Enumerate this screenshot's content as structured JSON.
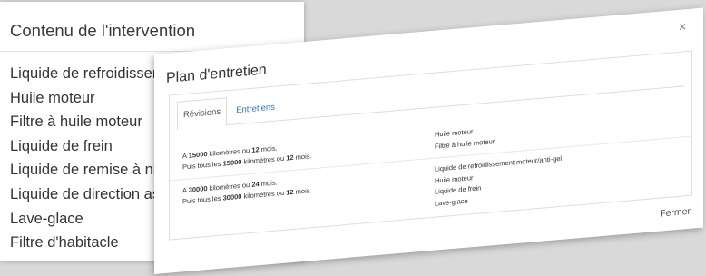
{
  "intervention": {
    "title": "Contenu de l'intervention",
    "items": [
      "Liquide de refroidissem",
      "Huile moteur",
      "Filtre à huile moteur",
      "Liquide de frein",
      "Liquide de remise à nive",
      "Liquide de direction assi",
      "Lave-glace",
      "Filtre d'habitacle"
    ]
  },
  "modal": {
    "title": "Plan d'entretien",
    "close_icon": "×",
    "tabs": [
      {
        "label": "Révisions",
        "active": true
      },
      {
        "label": "Entretiens",
        "active": false
      }
    ],
    "rows": [
      {
        "interval": [
          [
            "A ",
            "15000",
            " kilomètres ou ",
            "12",
            " mois."
          ],
          [
            "Puis tous les ",
            "15000",
            " kilomètres ou ",
            "12",
            " mois."
          ]
        ],
        "operations": [
          "Huile moteur",
          "Filtre à huile moteur"
        ]
      },
      {
        "interval": [
          [
            "A ",
            "30000",
            " kilomètres ou ",
            "24",
            " mois."
          ],
          [
            "Puis tous les ",
            "30000",
            " kilomètres ou ",
            "12",
            " mois."
          ]
        ],
        "operations": [
          "Liquide de refroidissement moteur/anti-gel",
          "Huile moteur",
          "Liquide de frein",
          "Lave-glace"
        ]
      }
    ],
    "close_button": "Fermer"
  },
  "colors": {
    "link": "#2f76c0",
    "stage_background": "#d9d9d9"
  }
}
